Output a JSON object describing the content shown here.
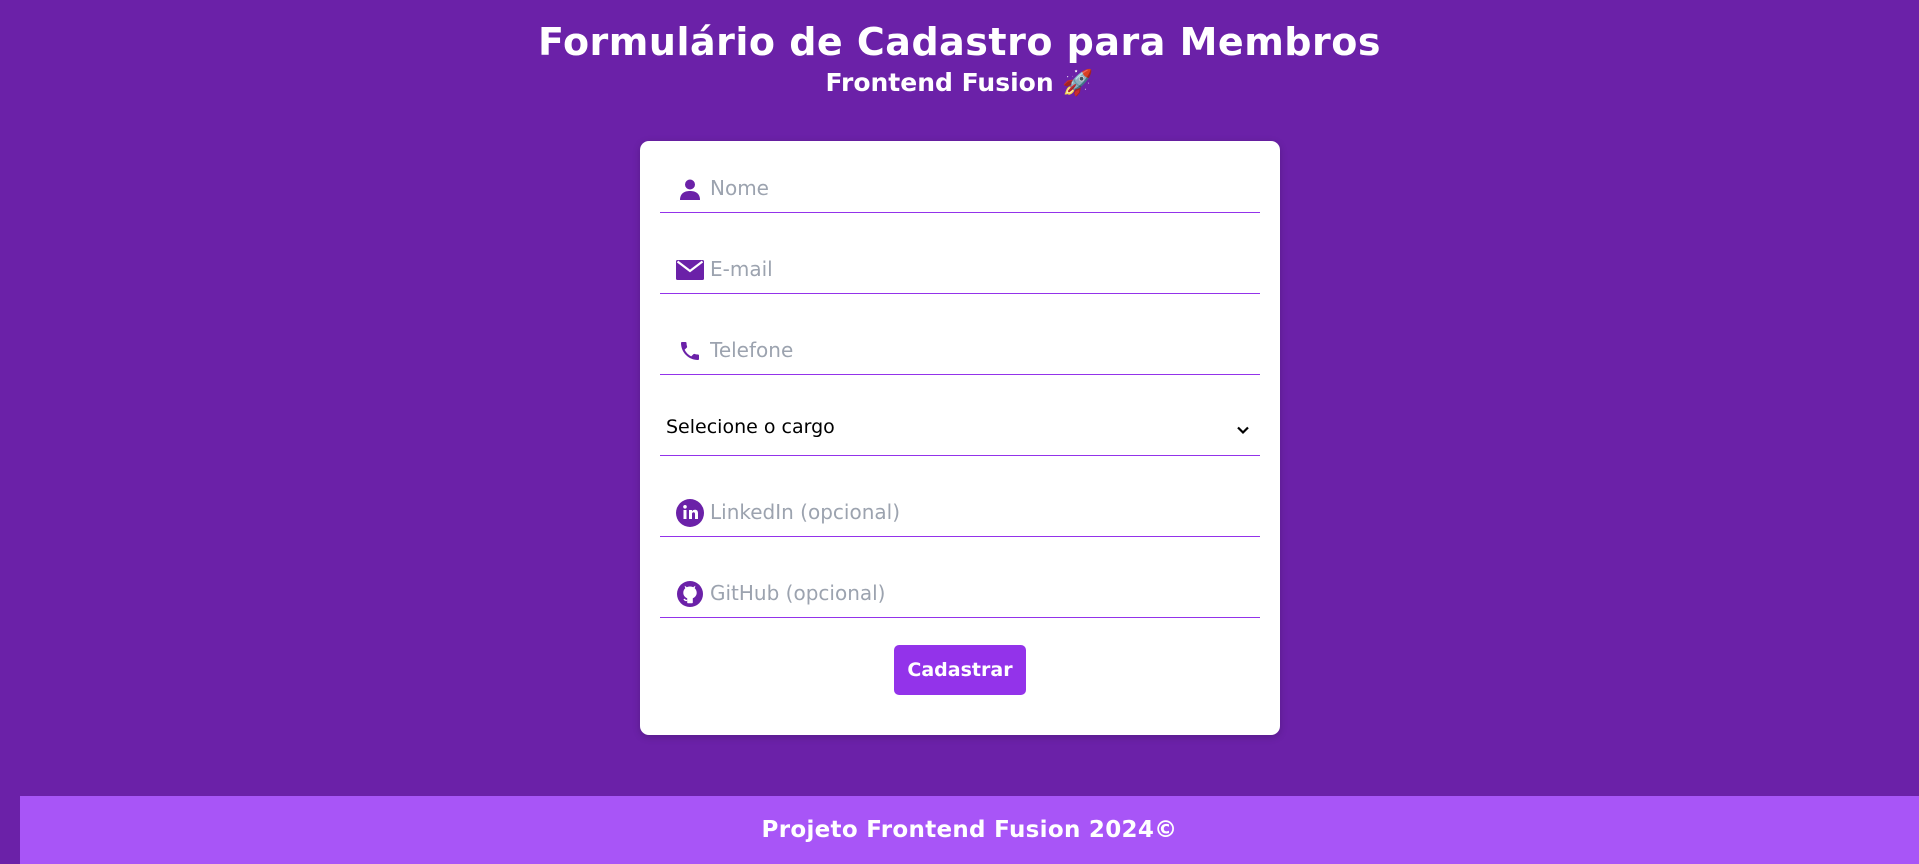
{
  "header": {
    "title": "Formulário de Cadastro para Membros",
    "subtitle": "Frontend Fusion 🚀"
  },
  "form": {
    "fields": [
      {
        "name": "nome",
        "placeholder": "Nome",
        "value": "",
        "icon": "user-icon"
      },
      {
        "name": "email",
        "placeholder": "E-mail",
        "value": "",
        "icon": "envelope-icon"
      },
      {
        "name": "telefone",
        "placeholder": "Telefone",
        "value": "",
        "icon": "phone-icon"
      },
      {
        "name": "linkedin",
        "placeholder": "LinkedIn (opcional)",
        "value": "",
        "icon": "linkedin-icon"
      },
      {
        "name": "github",
        "placeholder": "GitHub (opcional)",
        "value": "",
        "icon": "github-icon"
      }
    ],
    "role_select": {
      "selected": "Selecione o cargo"
    },
    "submit_label": "Cadastrar"
  },
  "footer": {
    "text": "Projeto Frontend Fusion 2024©"
  },
  "colors": {
    "background": "#6b21a8",
    "accent": "#9333ea",
    "footer": "#a855f7",
    "icon": "#6b21a8"
  }
}
